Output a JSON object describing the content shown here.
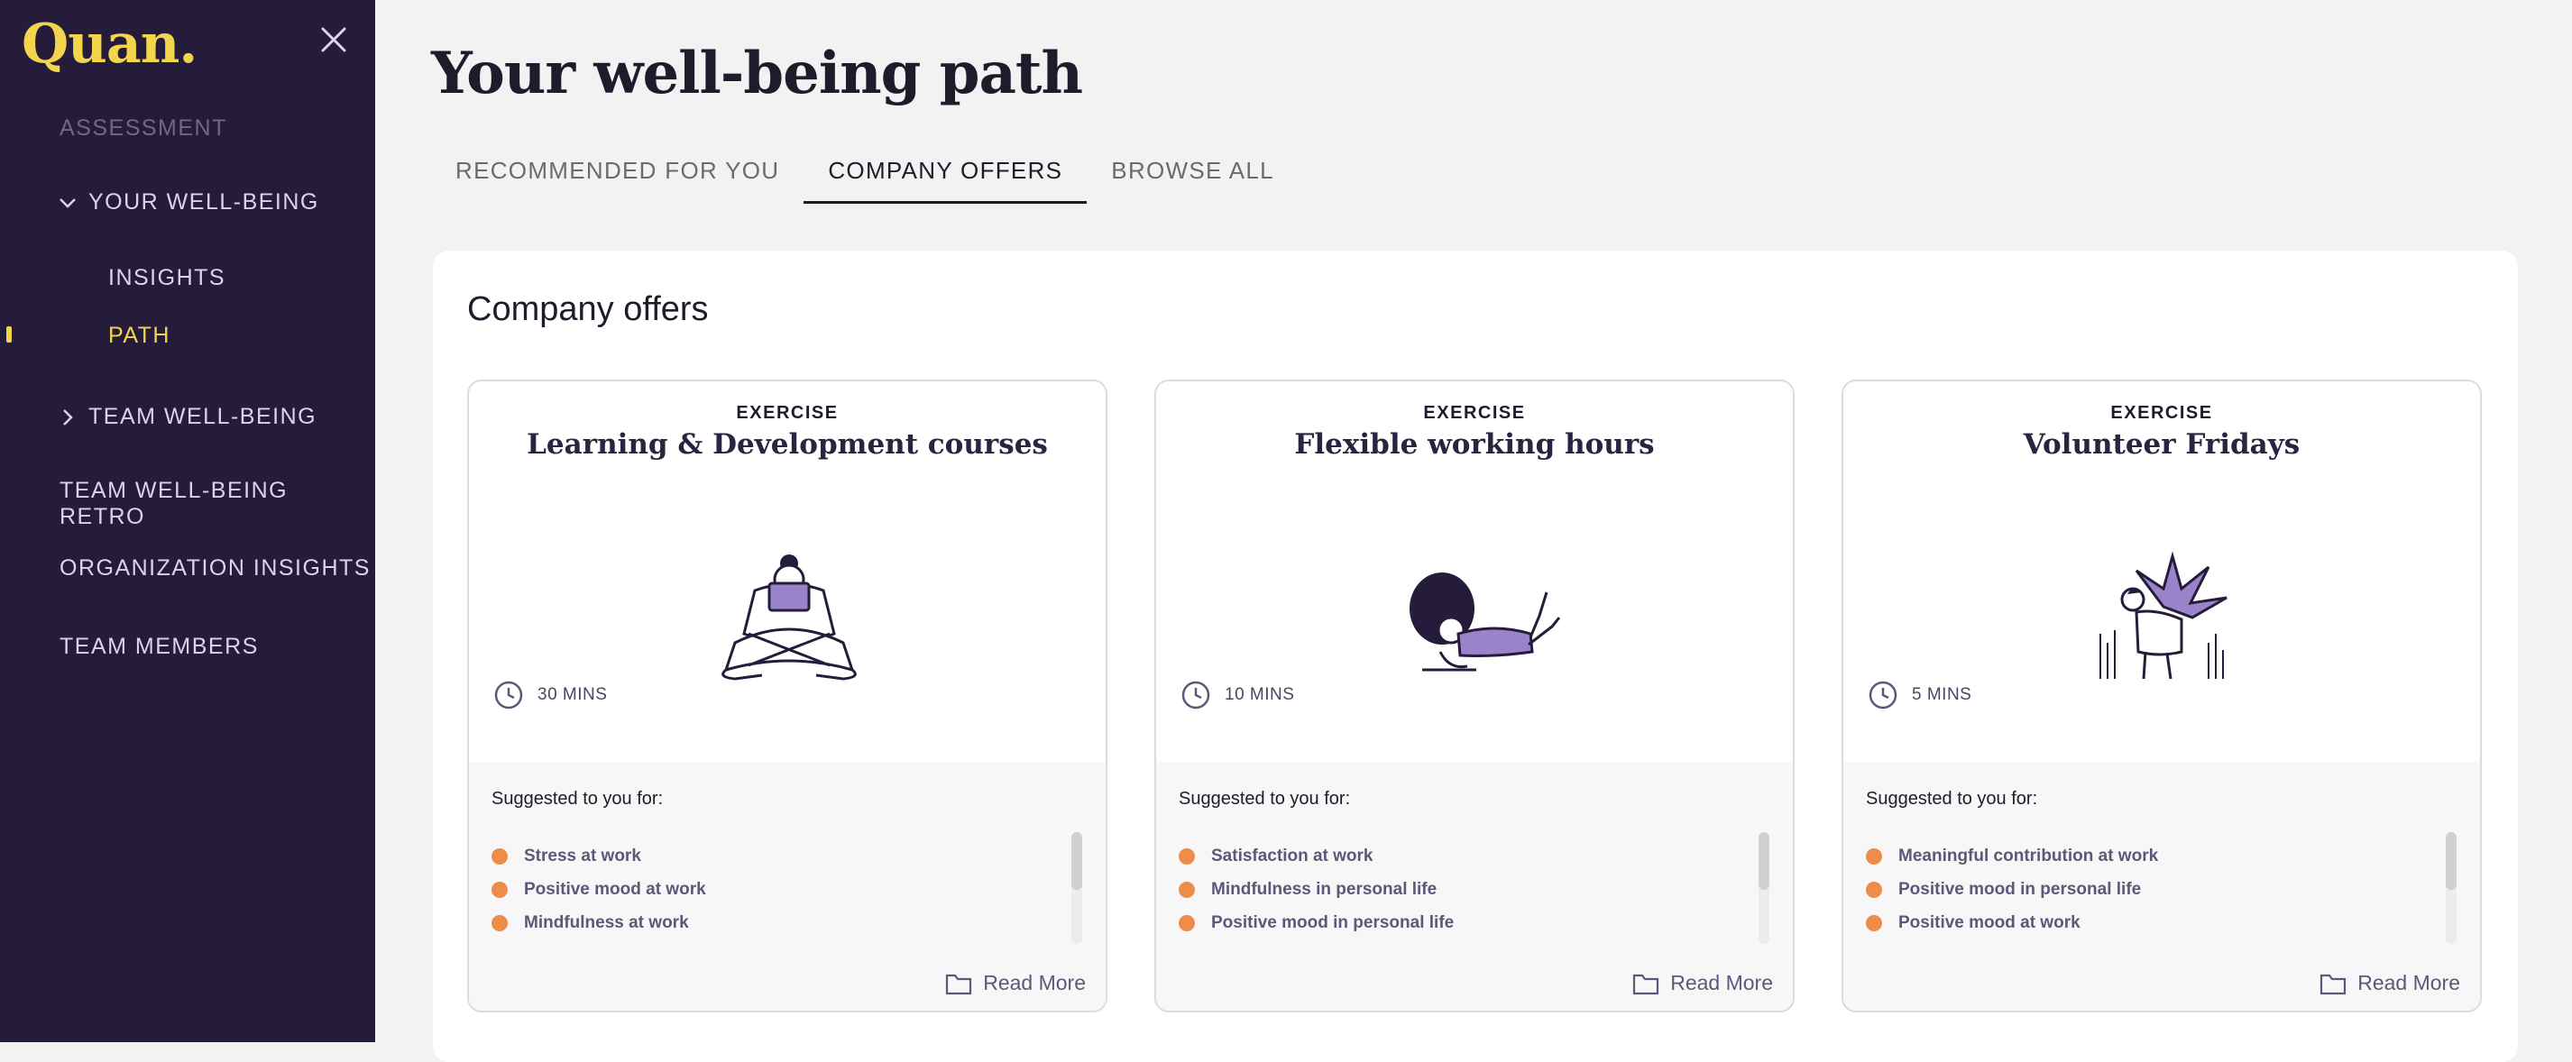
{
  "sidebar": {
    "logo": "Quan.",
    "items": [
      {
        "label": "ASSESSMENT"
      },
      {
        "label": "YOUR WELL-BEING"
      },
      {
        "label": "INSIGHTS"
      },
      {
        "label": "PATH"
      },
      {
        "label": "TEAM WELL-BEING"
      },
      {
        "label": "TEAM WELL-BEING RETRO"
      },
      {
        "label": "ORGANIZATION INSIGHTS"
      },
      {
        "label": "TEAM MEMBERS"
      }
    ],
    "active_item": "PATH"
  },
  "page": {
    "title": "Your well-being path"
  },
  "tabs": [
    {
      "label": "RECOMMENDED FOR YOU"
    },
    {
      "label": "COMPANY OFFERS"
    },
    {
      "label": "BROWSE ALL"
    }
  ],
  "selected_tab": "COMPANY OFFERS",
  "panel": {
    "title": "Company offers"
  },
  "cards": [
    {
      "type": "EXERCISE",
      "title": "Learning & Development courses",
      "illustration": "person-reading-cross-legged",
      "duration": "30 MINS",
      "suggest_label": "Suggested to you for:",
      "reasons": [
        "Stress at work",
        "Positive mood at work",
        "Mindfulness at work"
      ],
      "read_more": "Read More"
    },
    {
      "type": "EXERCISE",
      "title": "Flexible working hours",
      "illustration": "person-lying-writing",
      "duration": "10 MINS",
      "suggest_label": "Suggested to you for:",
      "reasons": [
        "Satisfaction at work",
        "Mindfulness in personal life",
        "Positive mood in personal life"
      ],
      "read_more": "Read More"
    },
    {
      "type": "EXERCISE",
      "title": "Volunteer Fridays",
      "illustration": "person-hugging-plant",
      "duration": "5 MINS",
      "suggest_label": "Suggested to you for:",
      "reasons": [
        "Meaningful contribution at work",
        "Positive mood in personal life",
        "Positive mood at work"
      ],
      "read_more": "Read More"
    }
  ],
  "colors": {
    "sidebar_bg": "#241c3a",
    "accent_yellow": "#f2d54a",
    "bullet_orange": "#ee8c4a",
    "illustration_purple": "#9a84c9"
  }
}
